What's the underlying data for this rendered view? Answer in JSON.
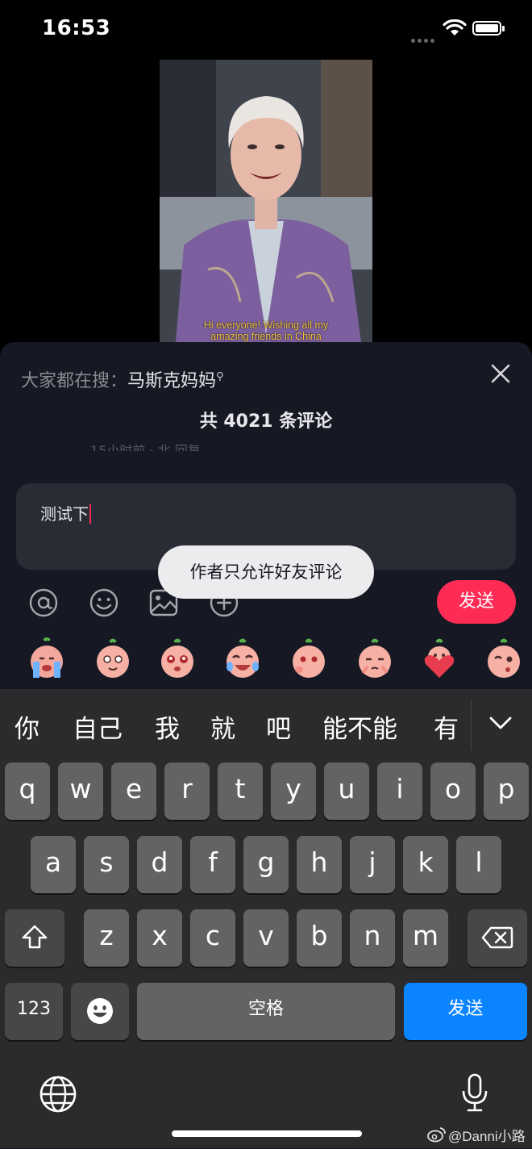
{
  "status_bar": {
    "time": "16:53"
  },
  "video": {
    "caption_line1": "Hi everyone! Wishing all my",
    "caption_line2": "amazing friends in China"
  },
  "comments": {
    "hot_search_label": "大家都在搜：",
    "hot_search_term": "马斯克妈妈",
    "count_text": "共 4021 条评论",
    "partial_row": "15小时前 · 北 回复"
  },
  "input": {
    "value": "测试下"
  },
  "toast": {
    "text": "作者只允许好友评论"
  },
  "toolbar": {
    "icons": [
      "at-icon",
      "emoji-icon",
      "image-icon",
      "plus-icon"
    ],
    "send_label": "发送"
  },
  "stickers": [
    "crying-sticker",
    "hopeful-sticker",
    "teary-eyed-sticker",
    "laugh-cry-sticker",
    "shy-sticker",
    "pleading-sticker",
    "heart-sticker",
    "wink-sticker"
  ],
  "keyboard": {
    "candidates": [
      "你",
      "自己",
      "我",
      "就",
      "吧",
      "能不能",
      "有"
    ],
    "row1": [
      "q",
      "w",
      "e",
      "r",
      "t",
      "y",
      "u",
      "i",
      "o",
      "p"
    ],
    "row2": [
      "a",
      "s",
      "d",
      "f",
      "g",
      "h",
      "j",
      "k",
      "l"
    ],
    "row3": [
      "z",
      "x",
      "c",
      "v",
      "b",
      "n",
      "m"
    ],
    "numbers_label": "123",
    "space_label": "空格",
    "send_label": "发送"
  },
  "watermark": "@Danni小路",
  "colors": {
    "accent_red": "#fe2c55",
    "keyboard_blue": "#0a84ff",
    "sheet_bg": "#161823",
    "key_bg": "#636366"
  }
}
